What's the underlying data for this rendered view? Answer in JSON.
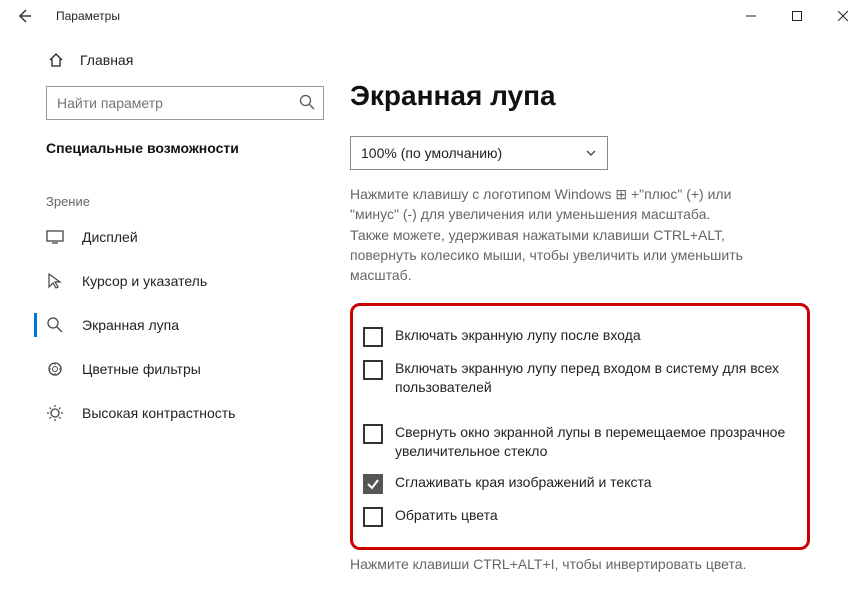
{
  "window": {
    "title": "Параметры"
  },
  "sidebar": {
    "home_label": "Главная",
    "search_placeholder": "Найти параметр",
    "section_title": "Специальные возможности",
    "group_label": "Зрение",
    "items": [
      {
        "label": "Дисплей"
      },
      {
        "label": "Курсор и указатель"
      },
      {
        "label": "Экранная лупа"
      },
      {
        "label": "Цветные фильтры"
      },
      {
        "label": "Высокая контрастность"
      }
    ]
  },
  "content": {
    "page_title": "Экранная лупа",
    "zoom_selected": "100% (по умолчанию)",
    "hint_line1": "Нажмите клавишу с логотипом Windows ⊞ +\"плюс\" (+) или \"минус\" (-) для увеличения или уменьшения масштаба.",
    "hint_line2": "Также можете, удерживая нажатыми клавиши CTRL+ALT, повернуть колесико мыши, чтобы увеличить или уменьшить масштаб.",
    "checkboxes": [
      {
        "label": "Включать экранную лупу после входа",
        "checked": false
      },
      {
        "label": "Включать экранную лупу перед входом в систему для всех пользователей",
        "checked": false
      },
      {
        "label": "Свернуть окно экранной лупы в перемещаемое прозрачное увеличительное стекло",
        "checked": false
      },
      {
        "label": "Сглаживать края изображений и текста",
        "checked": true
      },
      {
        "label": "Обратить цвета",
        "checked": false
      }
    ],
    "hint_invert": "Нажмите клавиши CTRL+ALT+I, чтобы инвертировать цвета."
  }
}
